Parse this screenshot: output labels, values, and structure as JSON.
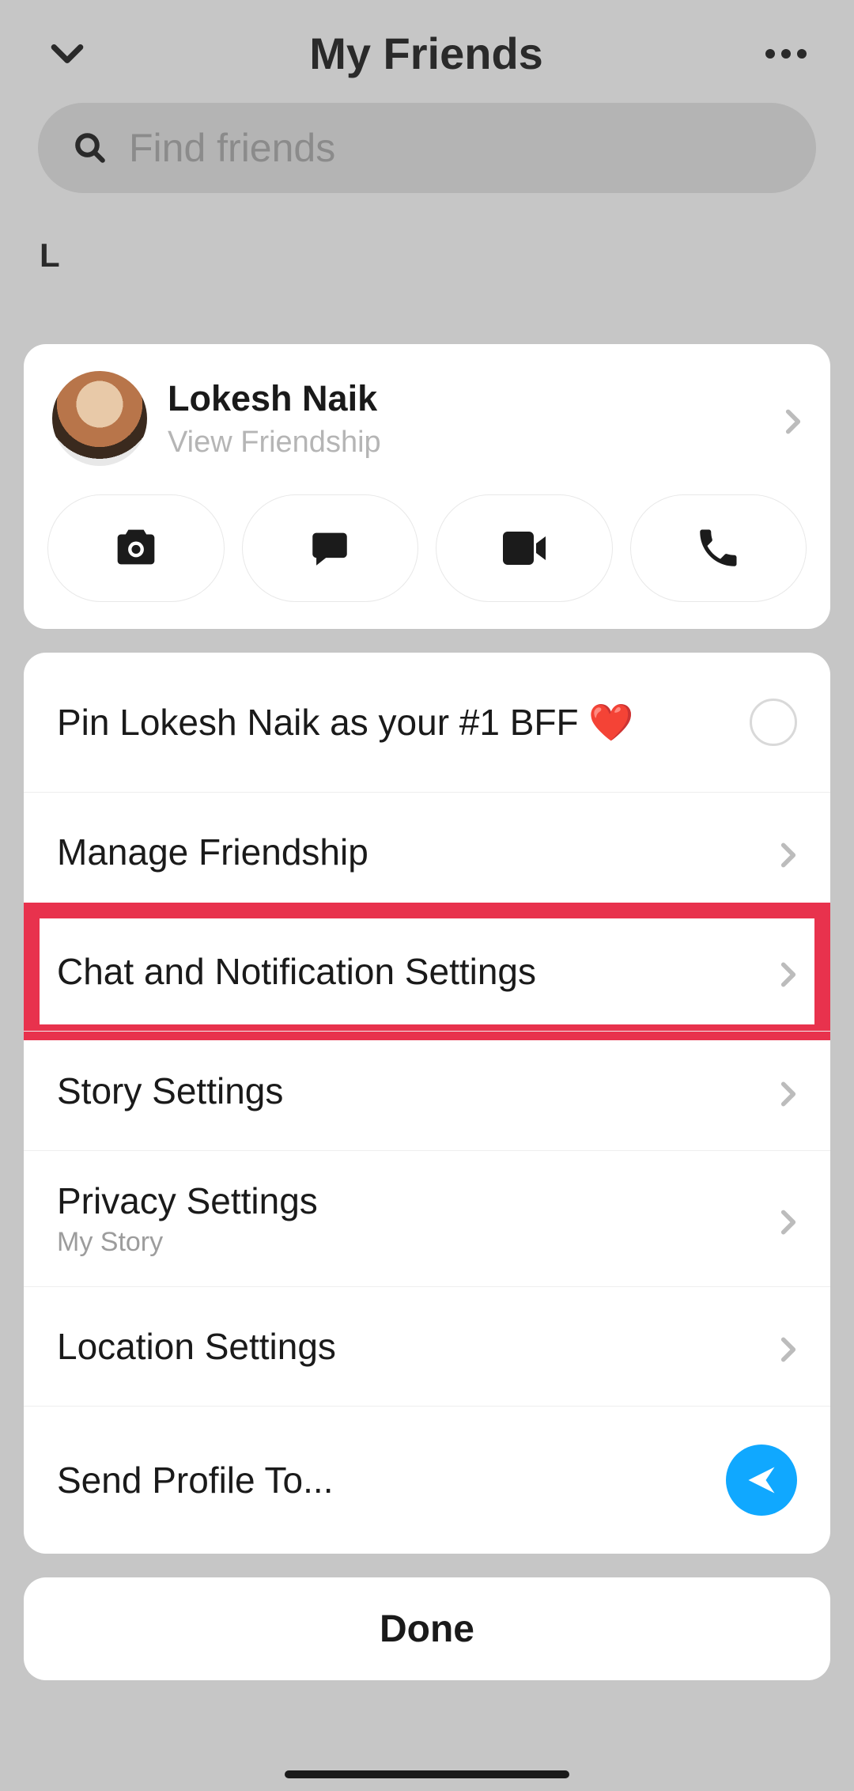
{
  "background": {
    "title": "My Friends",
    "search_placeholder": "Find friends",
    "section_letter": "L"
  },
  "friend": {
    "name": "Lokesh Naik",
    "subtitle": "View Friendship"
  },
  "pin_bff": {
    "label": "Pin Lokesh Naik as your #1 BFF ❤️"
  },
  "rows": {
    "manage": {
      "label": "Manage Friendship"
    },
    "chat_notif": {
      "label": "Chat and Notification Settings"
    },
    "story": {
      "label": "Story Settings"
    },
    "privacy": {
      "label": "Privacy Settings",
      "sub": "My Story"
    },
    "location": {
      "label": "Location Settings"
    },
    "send_profile": {
      "label": "Send Profile To..."
    }
  },
  "done": {
    "label": "Done"
  },
  "icons": {
    "camera": "camera-icon",
    "chat": "chat-icon",
    "video": "video-icon",
    "phone": "phone-icon",
    "send": "send-icon"
  },
  "colors": {
    "highlight": "#e8324d",
    "send_button": "#10A8FF"
  }
}
